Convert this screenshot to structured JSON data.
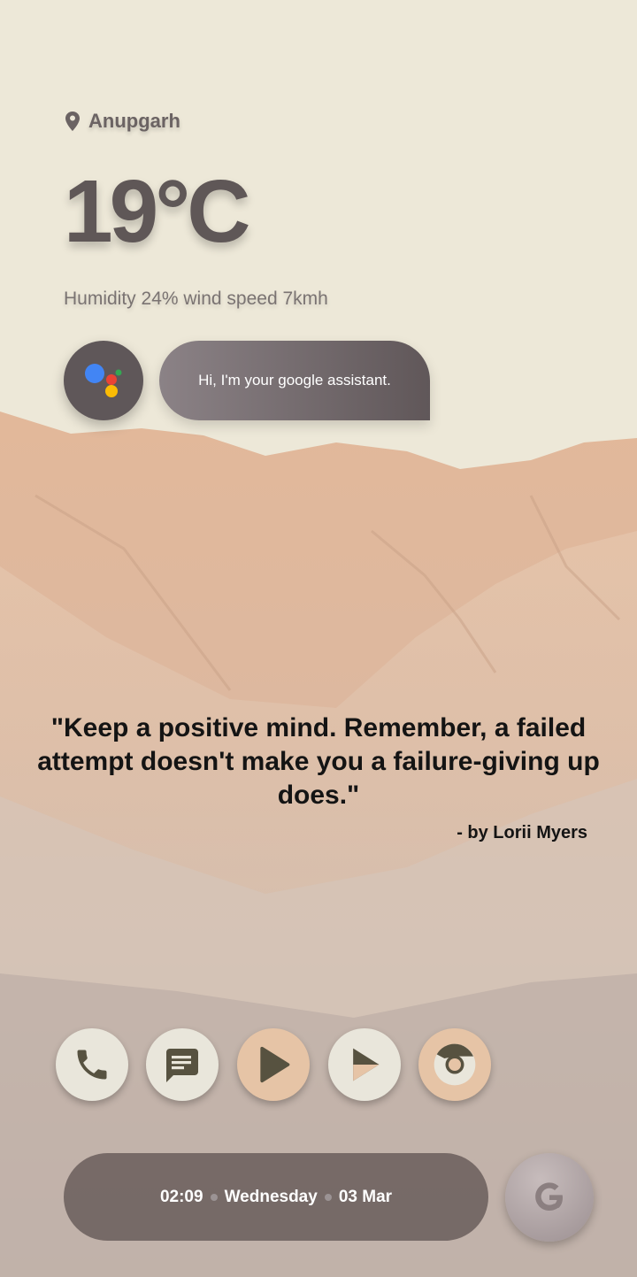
{
  "weather": {
    "location": "Anupgarh",
    "temperature": "19°C",
    "details": "Humidity 24% wind speed 7kmh"
  },
  "assistant": {
    "greeting": "Hi, I'm your google assistant."
  },
  "quote": {
    "text": "\"Keep a positive mind. Remember, a failed attempt doesn't make you a failure-giving up does.\"",
    "author": "- by Lorii Myers"
  },
  "dock": {
    "apps": [
      {
        "icon": "phone-icon"
      },
      {
        "icon": "messages-icon"
      },
      {
        "icon": "play-icon"
      },
      {
        "icon": "play-store-icon"
      },
      {
        "icon": "chrome-icon"
      }
    ]
  },
  "status_bar": {
    "time": "02:09",
    "day": "Wednesday",
    "date": "03 Mar"
  },
  "search": {
    "icon": "google-icon"
  },
  "colors": {
    "background": "#ede8d8",
    "accent_peach": "#e6c4a6",
    "icon_light": "#e9e6db",
    "icon_dark": "#575240"
  }
}
